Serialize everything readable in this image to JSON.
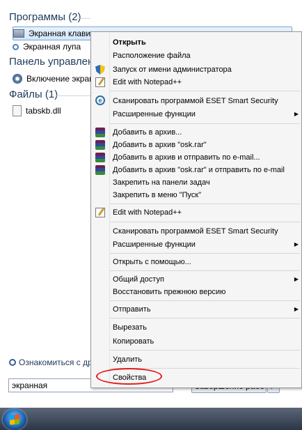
{
  "left_panel": {
    "programs_header": "Программы (2)",
    "programs": [
      "Экранная клавиатура",
      "Экранная лупа"
    ],
    "control_panel_header": "Панель управления",
    "control_panel_items": [
      "Включение экранн"
    ],
    "files_header": "Файлы (1)",
    "files": [
      "tabskb.dll"
    ],
    "learn_more": "Ознакомиться с друг"
  },
  "search": {
    "value": "экранная",
    "clear_symbol": "×"
  },
  "shutdown": {
    "label": "Завершение работы",
    "arrow": "▶"
  },
  "context_menu": {
    "items": [
      "Открыть",
      "Расположение файла",
      "Запуск от имени администратора",
      "Edit with Notepad++",
      "Сканировать программой ESET Smart Security",
      "Расширенные функции",
      "Добавить в архив...",
      "Добавить в архив \"osk.rar\"",
      "Добавить в архив и отправить по e-mail...",
      "Добавить в архив \"osk.rar\" и отправить по e-mail",
      "Закрепить на панели задач",
      "Закрепить в меню \"Пуск\"",
      "Edit with Notepad++",
      "Сканировать программой ESET Smart Security",
      "Расширенные функции",
      "Открыть с помощью...",
      "Общий доступ",
      "Восстановить прежнюю версию",
      "Отправить",
      "Вырезать",
      "Копировать",
      "Удалить",
      "Свойства"
    ],
    "submenu_arrow": "▶",
    "highlight_color": "#e11a1a"
  }
}
